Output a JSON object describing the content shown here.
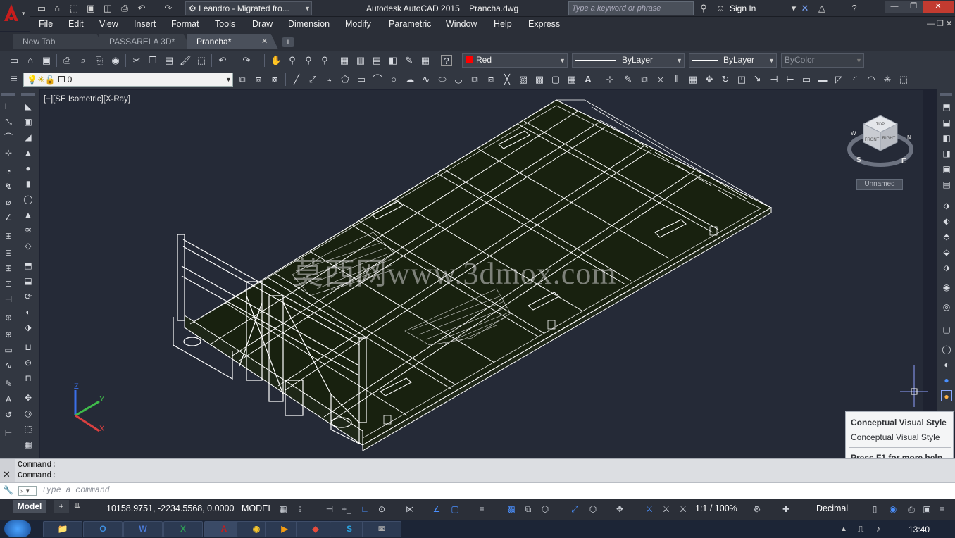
{
  "title_bar": {
    "workspace": "Leandro - Migrated fro...",
    "title": "Autodesk AutoCAD 2015    Prancha.dwg",
    "search_placeholder": "Type a keyword or phrase",
    "sign_in": "Sign In"
  },
  "menu": [
    "File",
    "Edit",
    "View",
    "Insert",
    "Format",
    "Tools",
    "Draw",
    "Dimension",
    "Modify",
    "Parametric",
    "Window",
    "Help",
    "Express"
  ],
  "doc_tabs": [
    {
      "label": "New Tab",
      "active": false
    },
    {
      "label": "PASSARELA 3D*",
      "active": false
    },
    {
      "label": "Prancha*",
      "active": true
    }
  ],
  "properties": {
    "color": "Red",
    "color_hex": "#ff0000",
    "linetype": "ByLayer",
    "lineweight": "ByLayer",
    "plotstyle": "ByColor",
    "layer": "0"
  },
  "viewport": {
    "label": "[−][SE Isometric][X-Ray]",
    "watermark": "莫西网www.3dmox.com",
    "viewcube_faces": {
      "top": "TOP",
      "front": "FRONT",
      "right": "RIGHT"
    },
    "compass": {
      "n": "N",
      "s": "S",
      "e": "E",
      "w": "W"
    },
    "ucs_label": "Unnamed",
    "axes": {
      "x": "X",
      "y": "Y",
      "z": "Z"
    }
  },
  "tooltip": {
    "title": "Conceptual Visual Style",
    "desc": "Conceptual Visual Style",
    "help": "Press F1 for more help"
  },
  "command": {
    "history": [
      "Command:",
      "Command:"
    ],
    "placeholder": "Type a command"
  },
  "status": {
    "model_tab": "Model",
    "coords": "10158.9751, -2234.5568, 0.0000",
    "space": "MODEL",
    "scale": "1:1 / 100%",
    "units": "Decimal"
  },
  "taskbar": {
    "time": "13:40"
  },
  "colors": {
    "accent": "#c71d1d",
    "viewport_bg": "#252a37",
    "wire": "#ffffff",
    "deck_fill": "#1a2414"
  }
}
